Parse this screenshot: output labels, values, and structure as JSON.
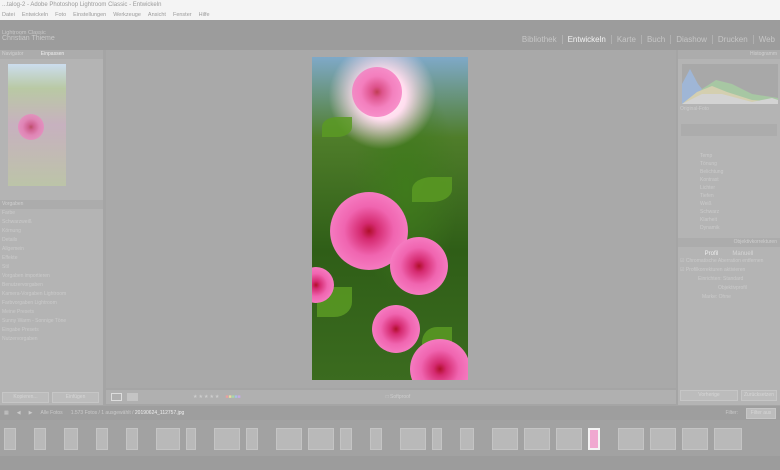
{
  "window": {
    "title": "...talog-2 - Adobe Photoshop Lightroom Classic - Entwickeln"
  },
  "menu": [
    "Datei",
    "Entwickeln",
    "Foto",
    "Einstellungen",
    "Werkzeuge",
    "Ansicht",
    "Fenster",
    "Hilfe"
  ],
  "identity": {
    "line1": "Lightroom Classic",
    "line2": "Christian Thieme"
  },
  "modules": [
    {
      "label": "Bibliothek"
    },
    {
      "label": "Entwickeln",
      "active": true
    },
    {
      "label": "Karte"
    },
    {
      "label": "Buch"
    },
    {
      "label": "Diashow"
    },
    {
      "label": "Drucken"
    },
    {
      "label": "Web"
    }
  ],
  "left": {
    "navigator": "Navigator",
    "zoom": "Einpassen",
    "presets": "Vorgaben",
    "items": [
      "Farbe",
      "Schwarzweiß",
      "Körnung",
      "Details",
      "Allgemein",
      "Effekte",
      "Stil",
      "Vorgaben importieren",
      "Benutzervorgaben",
      "Kamera-Vorgaben Lightroom",
      "Farbvorgaben Lightroom",
      "Meine Presets",
      "Sunny Warm - Sonnige Töne",
      "Eingabe Presets",
      "Nutzervorgaben"
    ],
    "copy": "Kopieren...",
    "paste": "Einfügen"
  },
  "right": {
    "histogram": "Histogramm",
    "original": "Original-Foto",
    "basic_labels": [
      "Temp",
      "Tönung",
      "Belichtung",
      "Kontrast",
      "Lichter",
      "Tiefen",
      "Weiß",
      "Schwarz",
      "Klarheit",
      "Dynamik"
    ],
    "lens": "Objektivkorrekturen",
    "tabs": [
      "Profil",
      "Manuell"
    ],
    "chk1": "Chromatische Aberration entfernen",
    "chk2": "Profilkorrekturen aktivieren",
    "setup_label": "Einrichten:",
    "setup_value": "Standard",
    "profile_label": "Objektivprofil",
    "make_label": "Marke:",
    "make_value": "Ohne",
    "prev": "Vorherige",
    "reset": "Zurücksetzen"
  },
  "toolbar": {
    "softproof": "Softproof"
  },
  "filmstrip": {
    "source": "Alle Fotos",
    "count": "1.573 Fotos / 1 ausgewählt /",
    "file": "20190624_112757.jpg",
    "filter": "Filter:",
    "filter_value": "Filter aus"
  },
  "colors": {
    "accent": "#f065b0"
  }
}
